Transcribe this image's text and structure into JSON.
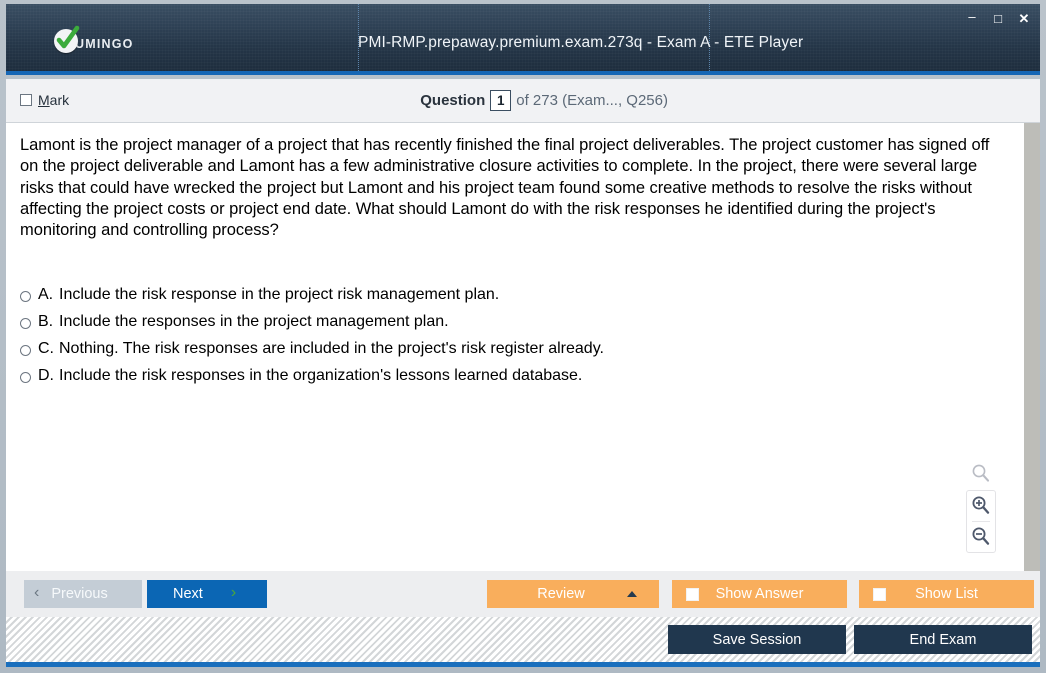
{
  "window": {
    "title": "PMI-RMP.prepaway.premium.exam.273q - Exam A - ETE Player",
    "logo_text": "UMINGO",
    "controls": {
      "minimize": "–",
      "maximize": "□",
      "close": "✕"
    }
  },
  "question_header": {
    "mark_label_prefix": "",
    "mark_label": "Mark",
    "mark_accel": "M",
    "mark_rest": "ark",
    "question_word": "Question",
    "question_number": "1",
    "rest": "of 273 (Exam..., Q256)"
  },
  "question": {
    "text": "Lamont is the project manager of a project that has recently finished the final project deliverables. The project customer has signed off on the project deliverable and Lamont has a few administrative closure activities to complete. In the project, there were several large risks that could have wrecked the project but Lamont and his project team found some creative methods to resolve the risks without affecting the project costs or project end date. What should Lamont do with the risk responses he identified during the project's monitoring and controlling process?",
    "options": [
      {
        "key": "A.",
        "text": "Include the risk response in the project risk management plan."
      },
      {
        "key": "B.",
        "text": "Include the responses in the project management plan."
      },
      {
        "key": "C.",
        "text": "Nothing. The risk responses are included in the project's risk register already."
      },
      {
        "key": "D.",
        "text": "Include the risk responses in the organization's lessons learned database."
      }
    ]
  },
  "zoom_tools": {
    "reset": "magnifier-icon",
    "zoom_in": "zoom-in-icon",
    "zoom_out": "zoom-out-icon"
  },
  "toolbar": {
    "previous": "Previous",
    "previous_chevron": "‹",
    "next": "Next",
    "next_chevron": "›",
    "review": "Review",
    "show_answer": "Show Answer",
    "show_list": "Show List"
  },
  "footer": {
    "save_session": "Save Session",
    "end_exam": "End Exam"
  },
  "colors": {
    "accent_blue": "#0b66b4",
    "orange": "#f9ae5c",
    "dark_navy": "#20374e",
    "header_gradient_top": "#3a4f63",
    "header_gradient_bottom": "#1d2c3c",
    "logo_green": "#3cab3c"
  }
}
